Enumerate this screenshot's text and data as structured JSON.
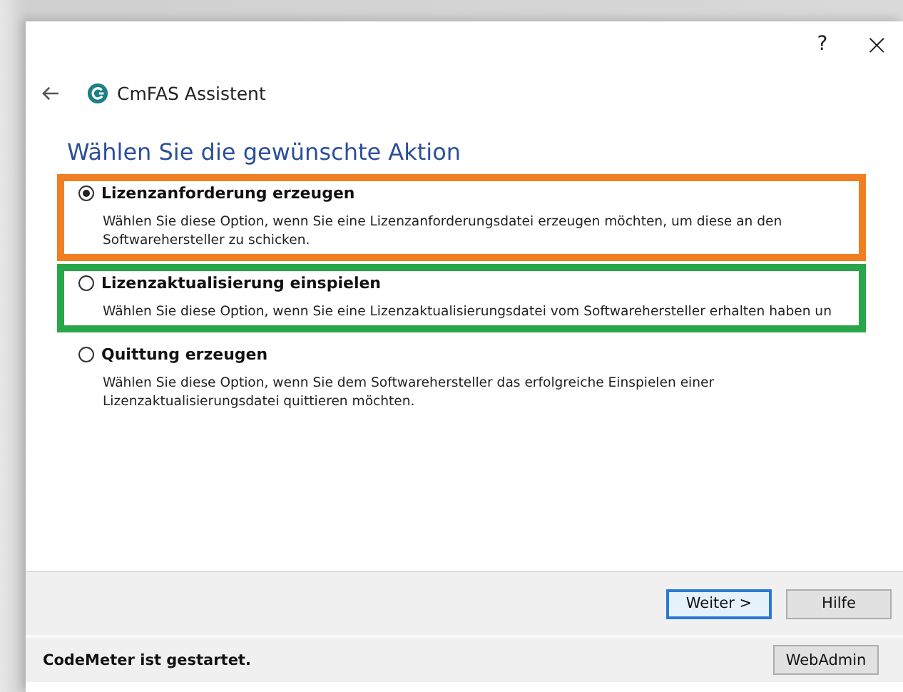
{
  "window": {
    "help": "?",
    "close": "×"
  },
  "header": {
    "title": "CmFAS Assistent"
  },
  "heading": "Wählen Sie die gewünschte Aktion",
  "options": [
    {
      "label": "Lizenzanforderung erzeugen",
      "description": "Wählen Sie diese Option, wenn Sie eine Lizenzanforderungsdatei erzeugen möchten, um diese an den Softwarehersteller zu schicken.",
      "selected": true,
      "color": "#f07f22"
    },
    {
      "label": "Lizenzaktualisierung einspielen",
      "description": "Wählen Sie diese Option, wenn Sie eine Lizenzaktualisierungsdatei vom Softwarehersteller erhalten haben un",
      "selected": false,
      "color": "#2aa64a"
    },
    {
      "label": "Quittung erzeugen",
      "description": "Wählen Sie diese Option, wenn Sie dem Softwarehersteller das erfolgreiche Einspielen einer Lizenzaktualisierungsdatei quittieren möchten.",
      "selected": false
    }
  ],
  "buttons": [
    {
      "label": "Weiter >",
      "default": true
    },
    {
      "label": "Hilfe",
      "default": false
    }
  ],
  "status_bar": {
    "text": "CodeMeter ist gestartet.",
    "button": "WebAdmin"
  }
}
